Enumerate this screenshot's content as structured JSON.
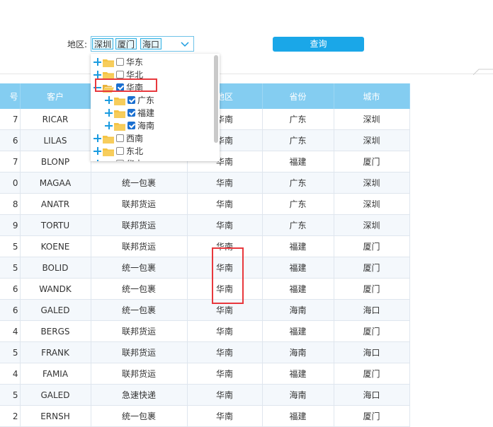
{
  "filter": {
    "region_label": "地区:",
    "selected_tags": [
      "深圳",
      "厦门",
      "海口"
    ],
    "query_button": "查询"
  },
  "tree": [
    {
      "label": "华东",
      "checked": false,
      "expanded": false
    },
    {
      "label": "华北",
      "checked": false,
      "expanded": false
    },
    {
      "label": "华南",
      "checked": true,
      "expanded": true
    },
    {
      "label": "广东",
      "checked": true,
      "child": true
    },
    {
      "label": "福建",
      "checked": true,
      "child": true
    },
    {
      "label": "海南",
      "checked": true,
      "child": true
    },
    {
      "label": "西南",
      "checked": false,
      "expanded": false
    },
    {
      "label": "东北",
      "checked": false,
      "expanded": false
    },
    {
      "label": "华中",
      "checked": false,
      "expanded": false
    }
  ],
  "table": {
    "headers": [
      "号",
      "客户",
      "",
      "地区",
      "省份",
      "城市"
    ],
    "rows": [
      [
        "7",
        "RICAR",
        "",
        "华南",
        "广东",
        "深圳"
      ],
      [
        "6",
        "LILAS",
        "",
        "华南",
        "广东",
        "深圳"
      ],
      [
        "7",
        "BLONP",
        "",
        "华南",
        "福建",
        "厦门"
      ],
      [
        "0",
        "MAGAA",
        "统一包裹",
        "华南",
        "广东",
        "深圳"
      ],
      [
        "8",
        "ANATR",
        "联邦货运",
        "华南",
        "广东",
        "深圳"
      ],
      [
        "9",
        "TORTU",
        "联邦货运",
        "华南",
        "广东",
        "深圳"
      ],
      [
        "5",
        "KOENE",
        "联邦货运",
        "华南",
        "福建",
        "厦门"
      ],
      [
        "5",
        "BOLID",
        "统一包裹",
        "华南",
        "福建",
        "厦门"
      ],
      [
        "6",
        "WANDK",
        "统一包裹",
        "华南",
        "福建",
        "厦门"
      ],
      [
        "6",
        "GALED",
        "统一包裹",
        "华南",
        "海南",
        "海口"
      ],
      [
        "4",
        "BERGS",
        "联邦货运",
        "华南",
        "福建",
        "厦门"
      ],
      [
        "5",
        "FRANK",
        "联邦货运",
        "华南",
        "海南",
        "海口"
      ],
      [
        "4",
        "FAMIA",
        "联邦货运",
        "华南",
        "福建",
        "厦门"
      ],
      [
        "5",
        "GALED",
        "急速快递",
        "华南",
        "海南",
        "海口"
      ],
      [
        "2",
        "ERNSH",
        "统一包裹",
        "华南",
        "福建",
        "厦门"
      ]
    ]
  },
  "colors": {
    "header_bg": "#84cdf1",
    "button_bg": "#1aa7e8",
    "highlight": "#e8383d",
    "folder": "#f5c445"
  }
}
